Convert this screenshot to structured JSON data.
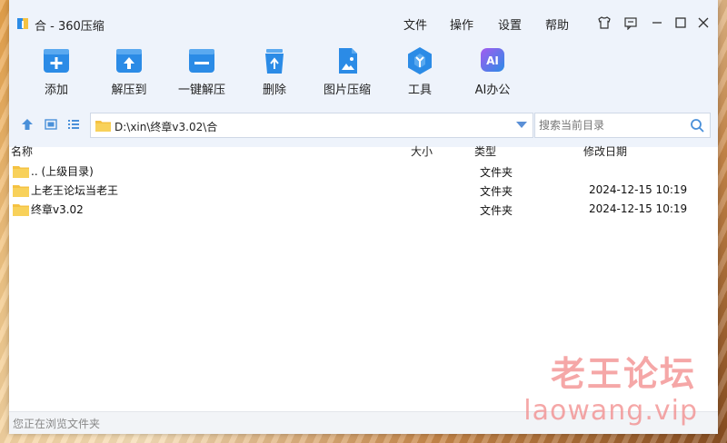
{
  "window": {
    "title": "合 - 360压缩"
  },
  "menu": {
    "file": "文件",
    "operate": "操作",
    "settings": "设置",
    "help": "帮助"
  },
  "toolbar": {
    "add": "添加",
    "extract_to": "解压到",
    "one_click_extract": "一键解压",
    "delete": "删除",
    "image_compress": "图片压缩",
    "tools": "工具",
    "ai_office": "AI办公",
    "ai_badge": "AI"
  },
  "address": {
    "path": "D:\\xin\\终章v3.02\\合"
  },
  "search": {
    "placeholder": "搜索当前目录"
  },
  "columns": {
    "name": "名称",
    "size": "大小",
    "type": "类型",
    "modified": "修改日期"
  },
  "files": [
    {
      "name": ".. (上级目录)",
      "size": "",
      "type": "文件夹",
      "modified": ""
    },
    {
      "name": "上老王论坛当老王",
      "size": "",
      "type": "文件夹",
      "modified": "2024-12-15 10:19"
    },
    {
      "name": "终章v3.02",
      "size": "",
      "type": "文件夹",
      "modified": "2024-12-15 10:19"
    }
  ],
  "status": {
    "text": "您正在浏览文件夹"
  },
  "watermark": {
    "line1": "老王论坛",
    "line2": "laowang.vip"
  },
  "colors": {
    "accent": "#2b8be6",
    "folder": "#f5c242",
    "watermark": "#f28a8a"
  }
}
